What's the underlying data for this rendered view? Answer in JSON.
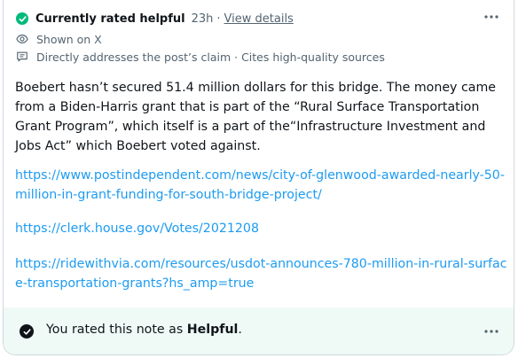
{
  "status": {
    "title": "Currently rated helpful",
    "time": "23h",
    "separator": "·",
    "view_details": "View details"
  },
  "meta": {
    "shown_on": "Shown on X",
    "reasons": "Directly addresses the post’s claim · Cites high-quality sources"
  },
  "note": {
    "body": "Boebert hasn’t secured 51.4 million dollars for this bridge. The money came from a Biden-Harris grant that is part of the “Rural Surface Transportation Grant Program”, which itself is a part of the“Infrastructure Investment and Jobs Act” which Boebert voted against.",
    "links": [
      "https://www.postindependent.com/news/city-of-glenwood-awarded-nearly-50-million-in-grant-funding-for-south-bridge-project/",
      "https://clerk.house.gov/Votes/2021208",
      "https://ridewithvia.com/resources/usdot-announces-780-million-in-rural-surface-transportation-grants?hs_amp=true"
    ]
  },
  "footer": {
    "rated_prefix": "You rated this note as ",
    "rated_value": "Helpful",
    "rated_suffix": "."
  },
  "colors": {
    "helpful_green": "#00ba7c",
    "link_blue": "#1d9bf0",
    "muted_gray": "#536471",
    "footer_bg": "#effaf6"
  },
  "icons": {
    "status": "check-circle-icon",
    "shown": "eye-icon",
    "reasons": "note-icon",
    "more": "more-horizontal-icon",
    "rated": "check-circle-filled-icon"
  }
}
